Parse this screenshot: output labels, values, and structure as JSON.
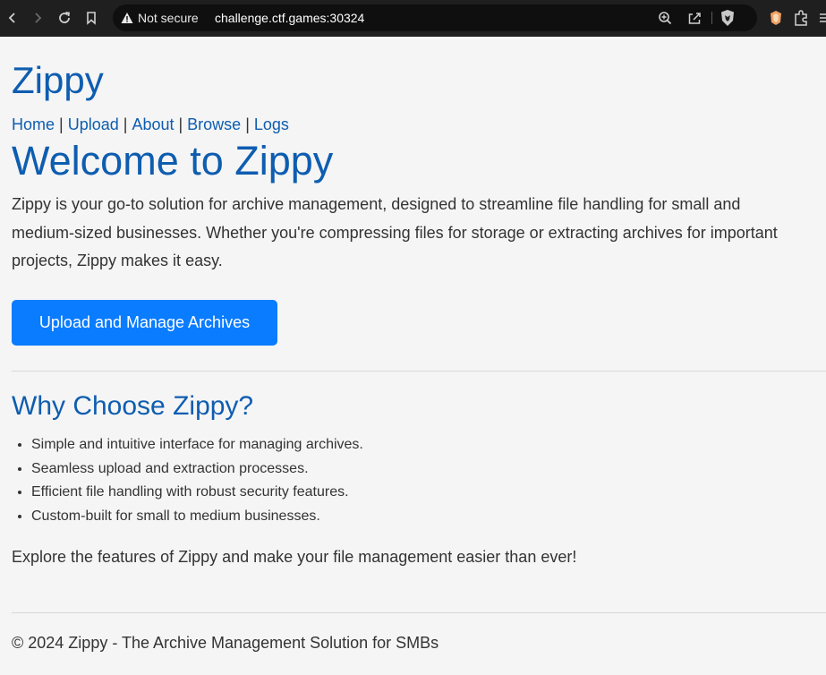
{
  "browser": {
    "security_label": "Not secure",
    "url": "challenge.ctf.games:30324"
  },
  "site": {
    "title": "Zippy",
    "nav": [
      "Home",
      "Upload",
      "About",
      "Browse",
      "Logs"
    ]
  },
  "hero": {
    "title": "Welcome to Zippy",
    "intro": "Zippy is your go-to solution for archive management, designed to streamline file handling for small and medium-sized businesses. Whether you're compressing files for storage or extracting archives for important projects, Zippy makes it easy.",
    "cta_label": "Upload and Manage Archives"
  },
  "why": {
    "title": "Why Choose Zippy?",
    "features": [
      "Simple and intuitive interface for managing archives.",
      "Seamless upload and extraction processes.",
      "Efficient file handling with robust security features.",
      "Custom-built for small to medium businesses."
    ]
  },
  "explore_text": "Explore the features of Zippy and make your file management easier than ever!",
  "footer_text": "© 2024 Zippy - The Archive Management Solution for SMBs",
  "colors": {
    "link": "#0e5db0",
    "button": "#0a7cff",
    "background": "#f5f5f5",
    "browser_chrome": "#1f1f1f"
  }
}
